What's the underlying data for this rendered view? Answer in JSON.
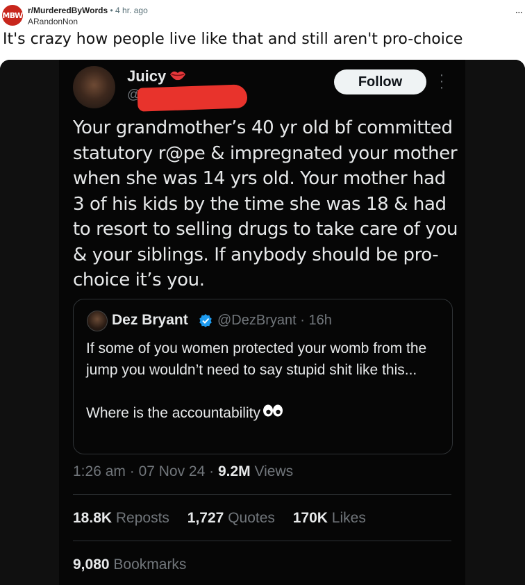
{
  "post": {
    "subreddit_icon": "MBW",
    "subreddit": "r/MurderedByWords",
    "separator": "•",
    "time": "4 hr. ago",
    "author": "ARandonNon",
    "more": "...",
    "title": "It's crazy how people live like that and still aren't pro-choice"
  },
  "tweet": {
    "name": "Juicy",
    "name_icon": "lips-icon",
    "handle_visible": "@",
    "follow_label": "Follow",
    "text": "Your grandmother’s 40 yr old bf committed statutory r@pe & impregnated your mother when she was 14 yrs old. Your mother had 3 of his kids by the time she was 18 & had to resort to selling drugs to take care of you & your siblings. If anybody should be pro-choice it’s you.",
    "time": "1:26 am",
    "date": "07 Nov 24",
    "views_count": "9.2M",
    "views_label": "Views",
    "reposts_count": "18.8K",
    "reposts_label": "Reposts",
    "quotes_count": "1,727",
    "quotes_label": "Quotes",
    "likes_count": "170K",
    "likes_label": "Likes",
    "bookmarks_count": "9,080",
    "bookmarks_label": "Bookmarks"
  },
  "quote": {
    "name": "Dez Bryant",
    "handle": "@DezBryant",
    "age": "16h",
    "text": "If some of you women protected your womb from the jump you wouldn’t need to say stupid shit like this...\n\nWhere is the accountability",
    "emoji": "eyes-icon"
  },
  "colors": {
    "reddit_icon": "#c8261c",
    "tweet_bg": "#060606",
    "text_primary": "#e7e9ea",
    "text_secondary": "#71767b",
    "verified_blue": "#1d9bf0",
    "redaction": "#e8332c"
  }
}
